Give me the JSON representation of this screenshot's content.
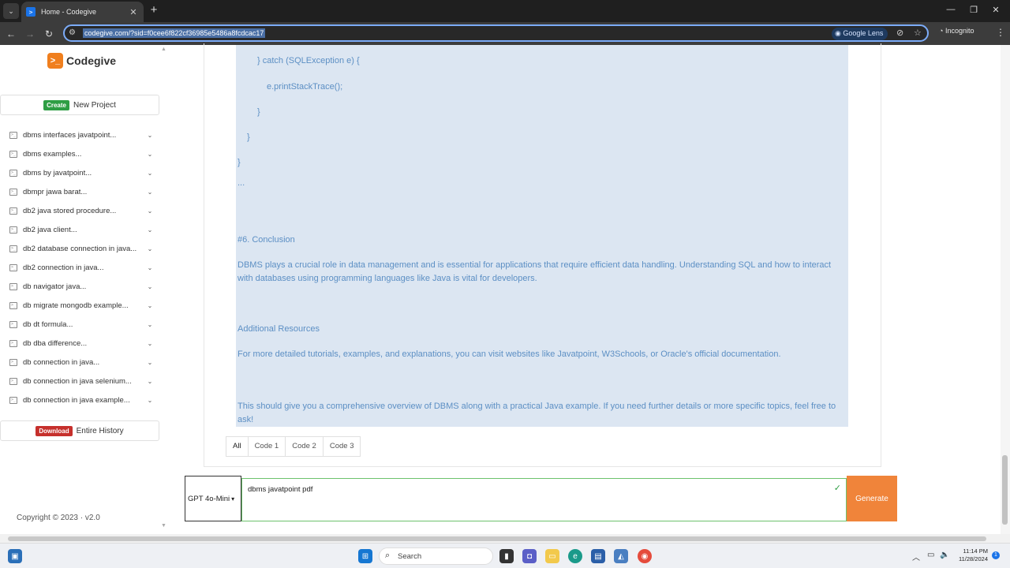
{
  "browser": {
    "tab_title": "Home - Codegive",
    "url": "codegive.com/?sid=f0cee6f822cf36985e5486a8fcdcac17",
    "lens_label": "Google Lens",
    "incognito_label": "Incognito"
  },
  "sidebar": {
    "logo_text": "Codegive",
    "create_badge": "Create",
    "create_label": "New Project",
    "history": [
      "dbms interfaces javatpoint...",
      "dbms examples...",
      "dbms by javatpoint...",
      "dbmpr jawa barat...",
      "db2 java stored procedure...",
      "db2 java client...",
      "db2 database connection in java...",
      "db2 connection in java...",
      "db navigator java...",
      "db migrate mongodb example...",
      "db dt formula...",
      "db dba difference...",
      "db connection in java...",
      "db connection in java selenium...",
      "db connection in java example..."
    ],
    "download_badge": "Download",
    "download_label": "Entire History",
    "footer": "Copyright © 2023  ·  v2.0"
  },
  "content": {
    "code_lines": [
      "} catch (SQLException e) {",
      "e.printStackTrace();",
      "}",
      "}",
      "}",
      "..."
    ],
    "conclusion_heading": "#6. Conclusion",
    "conclusion_text": "DBMS plays a crucial role in data management and is essential for applications that require efficient data handling. Understanding SQL and how to interact with databases using programming languages like Java is vital for developers.",
    "resources_heading": "Additional Resources",
    "resources_text": "For more detailed tutorials, examples, and explanations, you can visit websites like Javatpoint, W3Schools, or Oracle's official documentation.",
    "closing_text": "This should give you a comprehensive overview of DBMS along with a practical Java example. If you need further details or more specific topics, feel free to ask!",
    "tabs": [
      "All",
      "Code 1",
      "Code 2",
      "Code 3"
    ]
  },
  "composer": {
    "model": "GPT 4o-Mini",
    "prompt_value": "dbms javatpoint pdf",
    "generate_label": "Generate"
  },
  "taskbar": {
    "search_placeholder": "Search",
    "time": "11:14 PM",
    "date": "11/28/2024",
    "notification_count": "1"
  }
}
